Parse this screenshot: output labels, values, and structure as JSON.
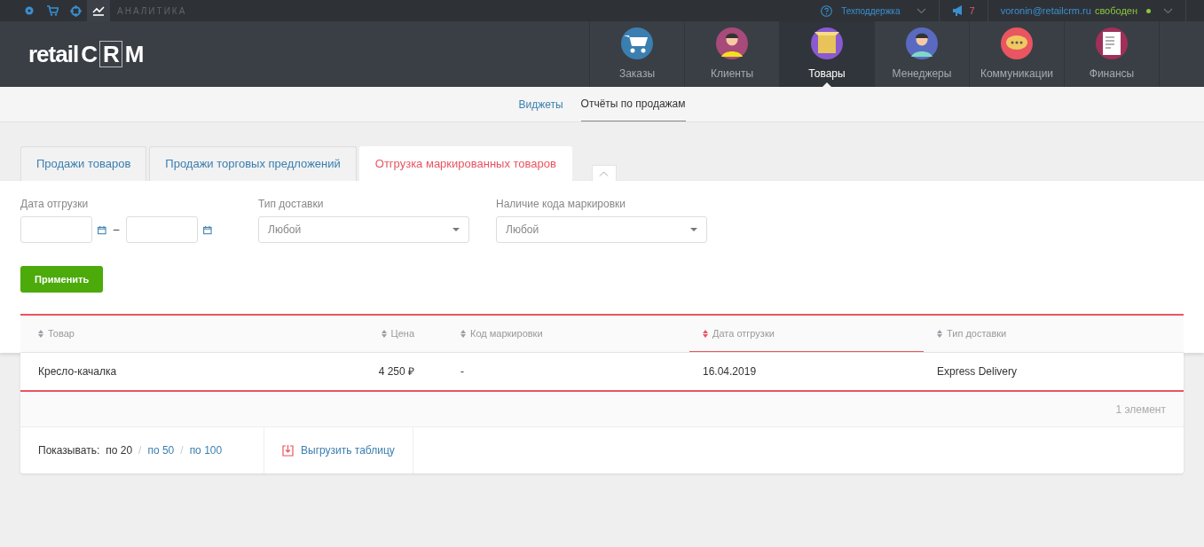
{
  "top_bar": {
    "tools": [
      {
        "selected": false
      },
      {
        "selected": false
      },
      {
        "selected": false
      },
      {
        "selected": true
      }
    ],
    "section": "АНАЛИТИКА",
    "support": "Техподдержка",
    "notifications": "7",
    "user": "voronin@retailcrm.ru",
    "status": "свободен"
  },
  "header": {
    "logo": {
      "prefix": "retail",
      "letters": [
        "C",
        "R",
        "M"
      ]
    },
    "nav": [
      {
        "label": "Заказы",
        "selected": false
      },
      {
        "label": "Клиенты",
        "selected": false
      },
      {
        "label": "Товары",
        "selected": true
      },
      {
        "label": "Менеджеры",
        "selected": false
      },
      {
        "label": "Коммуникации",
        "selected": false
      },
      {
        "label": "Финансы",
        "selected": false
      }
    ]
  },
  "subnav": [
    {
      "label": "Виджеты",
      "selected": false
    },
    {
      "label": "Отчёты по продажам",
      "selected": true
    }
  ],
  "report_tabs": [
    {
      "label": "Продажи товаров",
      "selected": false
    },
    {
      "label": "Продажи торговых предложений",
      "selected": false
    },
    {
      "label": "Отгрузка маркированных товаров",
      "selected": true
    }
  ],
  "filters": {
    "date": {
      "label": "Дата отгрузки",
      "separator": "–"
    },
    "selects": [
      {
        "label": "Тип доставки",
        "value": "Любой"
      },
      {
        "label": "Наличие кода маркировки",
        "value": "Любой"
      }
    ],
    "apply": "Применить"
  },
  "table": {
    "columns": [
      {
        "label": "Товар",
        "sorted": false
      },
      {
        "label": "Цена",
        "sorted": false
      },
      {
        "label": "Код маркировки",
        "sorted": false
      },
      {
        "label": "Дата отгрузки",
        "sorted": true
      },
      {
        "label": "Тип доставки",
        "sorted": false
      }
    ],
    "rows": [
      [
        "Кресло-качалка",
        "4 250 ₽",
        "-",
        "16.04.2019",
        "Express Delivery"
      ]
    ],
    "count": "1 элемент"
  },
  "footer": {
    "show_label": "Показывать:",
    "page_sizes": [
      {
        "label": "по 20",
        "selected": true
      },
      {
        "label": "по 50",
        "selected": false
      },
      {
        "label": "по 100",
        "selected": false
      }
    ],
    "separators": [
      "/",
      "/"
    ],
    "export": "Выгрузить таблицу"
  }
}
